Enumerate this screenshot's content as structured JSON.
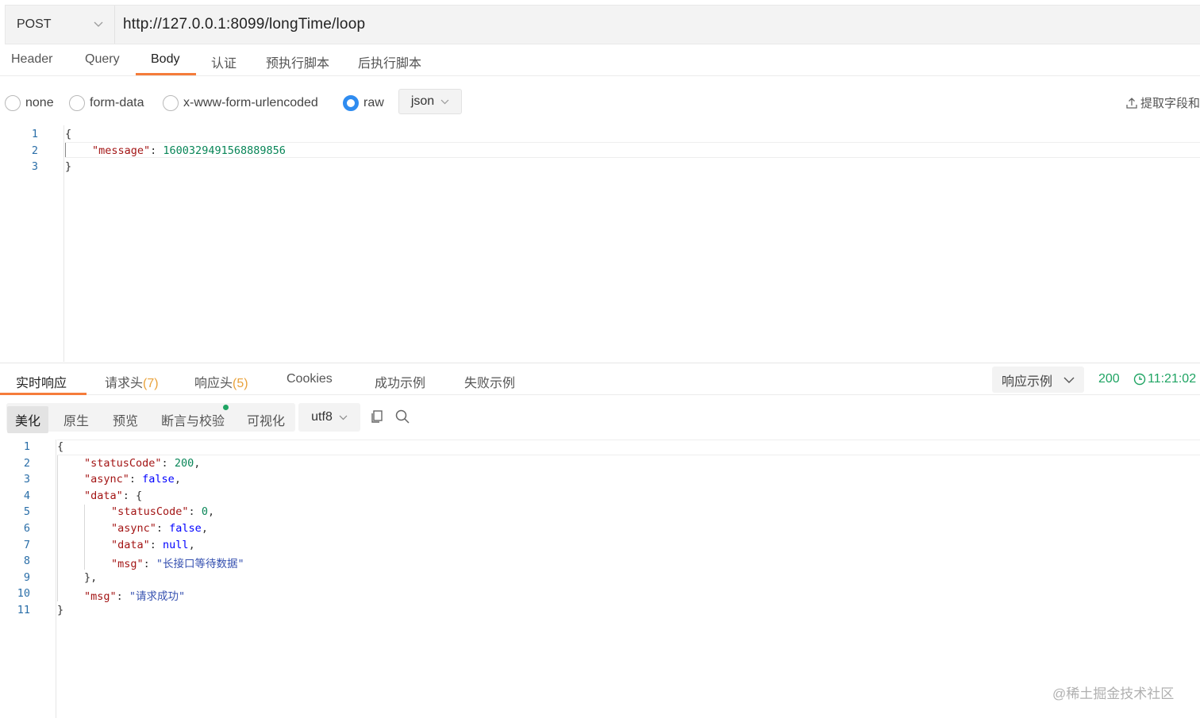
{
  "request": {
    "method": "POST",
    "url": "http://127.0.0.1:8099/longTime/loop"
  },
  "request_tabs": [
    {
      "label": "Header"
    },
    {
      "label": "Query"
    },
    {
      "label": "Body"
    },
    {
      "label": "认证"
    },
    {
      "label": "预执行脚本"
    },
    {
      "label": "后执行脚本"
    }
  ],
  "body_types": [
    {
      "label": "none",
      "checked": false
    },
    {
      "label": "form-data",
      "checked": false
    },
    {
      "label": "x-www-form-urlencoded",
      "checked": false
    },
    {
      "label": "raw",
      "checked": true
    }
  ],
  "raw_format": "json",
  "extract_label": "提取字段和",
  "request_body": {
    "line_numbers": [
      "1",
      "2",
      "3"
    ],
    "lines": [
      {
        "parts": [
          {
            "t": "{",
            "c": "p"
          }
        ]
      },
      {
        "parts": [
          {
            "t": "\"message\"",
            "c": "k"
          },
          {
            "t": ": ",
            "c": "p"
          },
          {
            "t": "1600329491568889856",
            "c": "n"
          }
        ]
      },
      {
        "parts": [
          {
            "t": "}",
            "c": "p"
          }
        ]
      }
    ]
  },
  "response_tabs": [
    {
      "label": "实时响应",
      "count": ""
    },
    {
      "label": "请求头",
      "count": "(7)"
    },
    {
      "label": "响应头",
      "count": "(5)"
    },
    {
      "label": "Cookies",
      "count": ""
    },
    {
      "label": "成功示例",
      "count": ""
    },
    {
      "label": "失败示例",
      "count": ""
    }
  ],
  "response_example_label": "响应示例",
  "status": {
    "code": "200",
    "time": "11:21:02"
  },
  "view_tabs": [
    {
      "label": "美化"
    },
    {
      "label": "原生"
    },
    {
      "label": "预览"
    },
    {
      "label": "断言与校验"
    },
    {
      "label": "可视化"
    }
  ],
  "encoding": "utf8",
  "response_body": {
    "line_numbers": [
      "1",
      "2",
      "3",
      "4",
      "5",
      "6",
      "7",
      "8",
      "9",
      "10",
      "11"
    ],
    "lines": [
      {
        "indent": 0,
        "parts": [
          {
            "t": "{",
            "c": "p"
          }
        ]
      },
      {
        "indent": 1,
        "parts": [
          {
            "t": "\"statusCode\"",
            "c": "k"
          },
          {
            "t": ": ",
            "c": "p"
          },
          {
            "t": "200",
            "c": "n"
          },
          {
            "t": ",",
            "c": "p"
          }
        ]
      },
      {
        "indent": 1,
        "parts": [
          {
            "t": "\"async\"",
            "c": "k"
          },
          {
            "t": ": ",
            "c": "p"
          },
          {
            "t": "false",
            "c": "b"
          },
          {
            "t": ",",
            "c": "p"
          }
        ]
      },
      {
        "indent": 1,
        "parts": [
          {
            "t": "\"data\"",
            "c": "k"
          },
          {
            "t": ": {",
            "c": "p"
          }
        ]
      },
      {
        "indent": 2,
        "parts": [
          {
            "t": "\"statusCode\"",
            "c": "k"
          },
          {
            "t": ": ",
            "c": "p"
          },
          {
            "t": "0",
            "c": "n"
          },
          {
            "t": ",",
            "c": "p"
          }
        ]
      },
      {
        "indent": 2,
        "parts": [
          {
            "t": "\"async\"",
            "c": "k"
          },
          {
            "t": ": ",
            "c": "p"
          },
          {
            "t": "false",
            "c": "b"
          },
          {
            "t": ",",
            "c": "p"
          }
        ]
      },
      {
        "indent": 2,
        "parts": [
          {
            "t": "\"data\"",
            "c": "k"
          },
          {
            "t": ": ",
            "c": "p"
          },
          {
            "t": "null",
            "c": "b"
          },
          {
            "t": ",",
            "c": "p"
          }
        ]
      },
      {
        "indent": 2,
        "parts": [
          {
            "t": "\"msg\"",
            "c": "k"
          },
          {
            "t": ": ",
            "c": "p"
          },
          {
            "t": "\"长接口等待数据\"",
            "c": "s"
          }
        ]
      },
      {
        "indent": 1,
        "parts": [
          {
            "t": "},",
            "c": "p"
          }
        ]
      },
      {
        "indent": 1,
        "parts": [
          {
            "t": "\"msg\"",
            "c": "k"
          },
          {
            "t": ": ",
            "c": "p"
          },
          {
            "t": "\"请求成功\"",
            "c": "s"
          }
        ]
      },
      {
        "indent": 0,
        "parts": [
          {
            "t": "}",
            "c": "p"
          }
        ]
      }
    ]
  },
  "watermark": "@稀土掘金技术社区",
  "colors": {
    "accent": "#f57c3a",
    "success": "#1fa463",
    "radio": "#2f8cf0",
    "count": "#e9a23b"
  }
}
